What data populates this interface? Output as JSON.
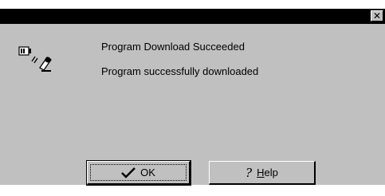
{
  "window": {
    "close_glyph": "✕"
  },
  "message": {
    "title": "Program Download Succeeded",
    "body": "Program successfully downloaded"
  },
  "icons": {
    "status": "device-link-icon",
    "ok": "checkmark-icon",
    "help": "question-mark-icon"
  },
  "buttons": {
    "ok_label": "OK",
    "help_glyph": "?",
    "help_label": "Help"
  },
  "colors": {
    "titlebar": "#000000",
    "dialog_bg": "#c0c0c0"
  }
}
